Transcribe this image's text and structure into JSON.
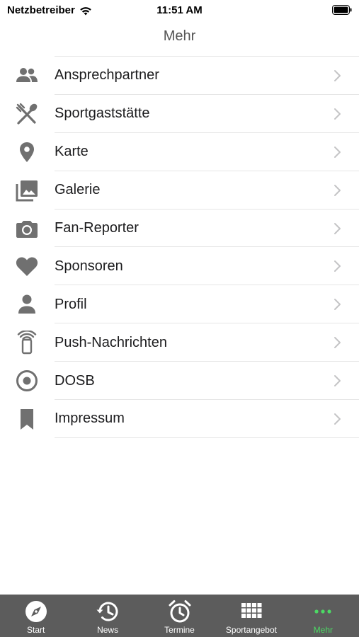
{
  "status_bar": {
    "carrier": "Netzbetreiber",
    "time": "11:51 AM"
  },
  "header": {
    "title": "Mehr"
  },
  "menu": {
    "items": [
      {
        "label": "Ansprechpartner",
        "icon": "people-icon"
      },
      {
        "label": "Sportgaststätte",
        "icon": "restaurant-icon"
      },
      {
        "label": "Karte",
        "icon": "map-pin-icon"
      },
      {
        "label": "Galerie",
        "icon": "gallery-icon"
      },
      {
        "label": "Fan-Reporter",
        "icon": "camera-icon"
      },
      {
        "label": "Sponsoren",
        "icon": "heart-icon"
      },
      {
        "label": "Profil",
        "icon": "person-icon"
      },
      {
        "label": "Push-Nachrichten",
        "icon": "phone-signal-icon"
      },
      {
        "label": "DOSB",
        "icon": "target-icon"
      },
      {
        "label": "Impressum",
        "icon": "bookmark-icon"
      }
    ]
  },
  "tab_bar": {
    "tabs": [
      {
        "label": "Start",
        "icon": "compass-icon"
      },
      {
        "label": "News",
        "icon": "history-icon"
      },
      {
        "label": "Termine",
        "icon": "alarm-clock-icon"
      },
      {
        "label": "Sportangebot",
        "icon": "grid-icon"
      },
      {
        "label": "Mehr",
        "icon": "more-icon",
        "active": true
      }
    ]
  },
  "colors": {
    "icon": "#707070",
    "tab_bar": "#5c5c5c",
    "active_tab": "#4cd964",
    "divider": "#e6e6e6"
  }
}
